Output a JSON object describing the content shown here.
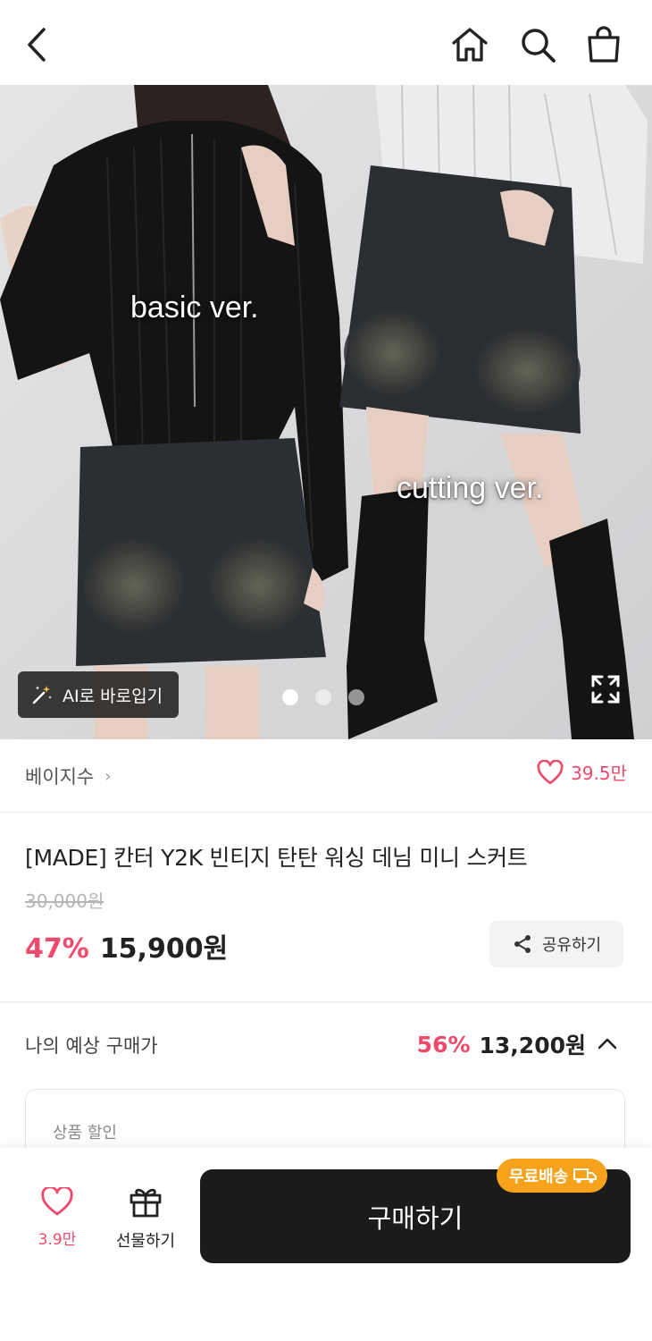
{
  "header": {
    "back_icon": "chevron-left-icon",
    "home_icon": "home-icon",
    "search_icon": "search-icon",
    "cart_icon": "shopping-bag-icon"
  },
  "hero": {
    "label_left": "basic ver.",
    "label_right": "cutting ver.",
    "ai_button_label": "AI로 바로입기",
    "ai_icon": "magic-wand-icon",
    "expand_icon": "expand-icon",
    "slide_count": 3,
    "active_slide": 1
  },
  "brand": {
    "name": "베이지수",
    "chevron": "›",
    "likes": "39.5만"
  },
  "product": {
    "title": "[MADE] 칸터 Y2K 빈티지 탄탄 워싱 데님 미니 스커트",
    "original_price": "30,000원",
    "discount": "47%",
    "price": "15,900원",
    "share_label": "공유하기"
  },
  "estimate": {
    "label": "나의 예상 구매가",
    "discount": "56%",
    "price": "13,200원",
    "chevron": "^"
  },
  "discount_card": {
    "label": "상품 할인"
  },
  "bottom": {
    "wish_count": "3.9만",
    "gift_label": "선물하기",
    "buy_label": "구매하기",
    "free_shipping": "무료배송"
  },
  "colors": {
    "accent_pink": "#ef4a6b",
    "buy_button": "#1b1b1b",
    "free_ship_badge": "#f6a21b"
  }
}
